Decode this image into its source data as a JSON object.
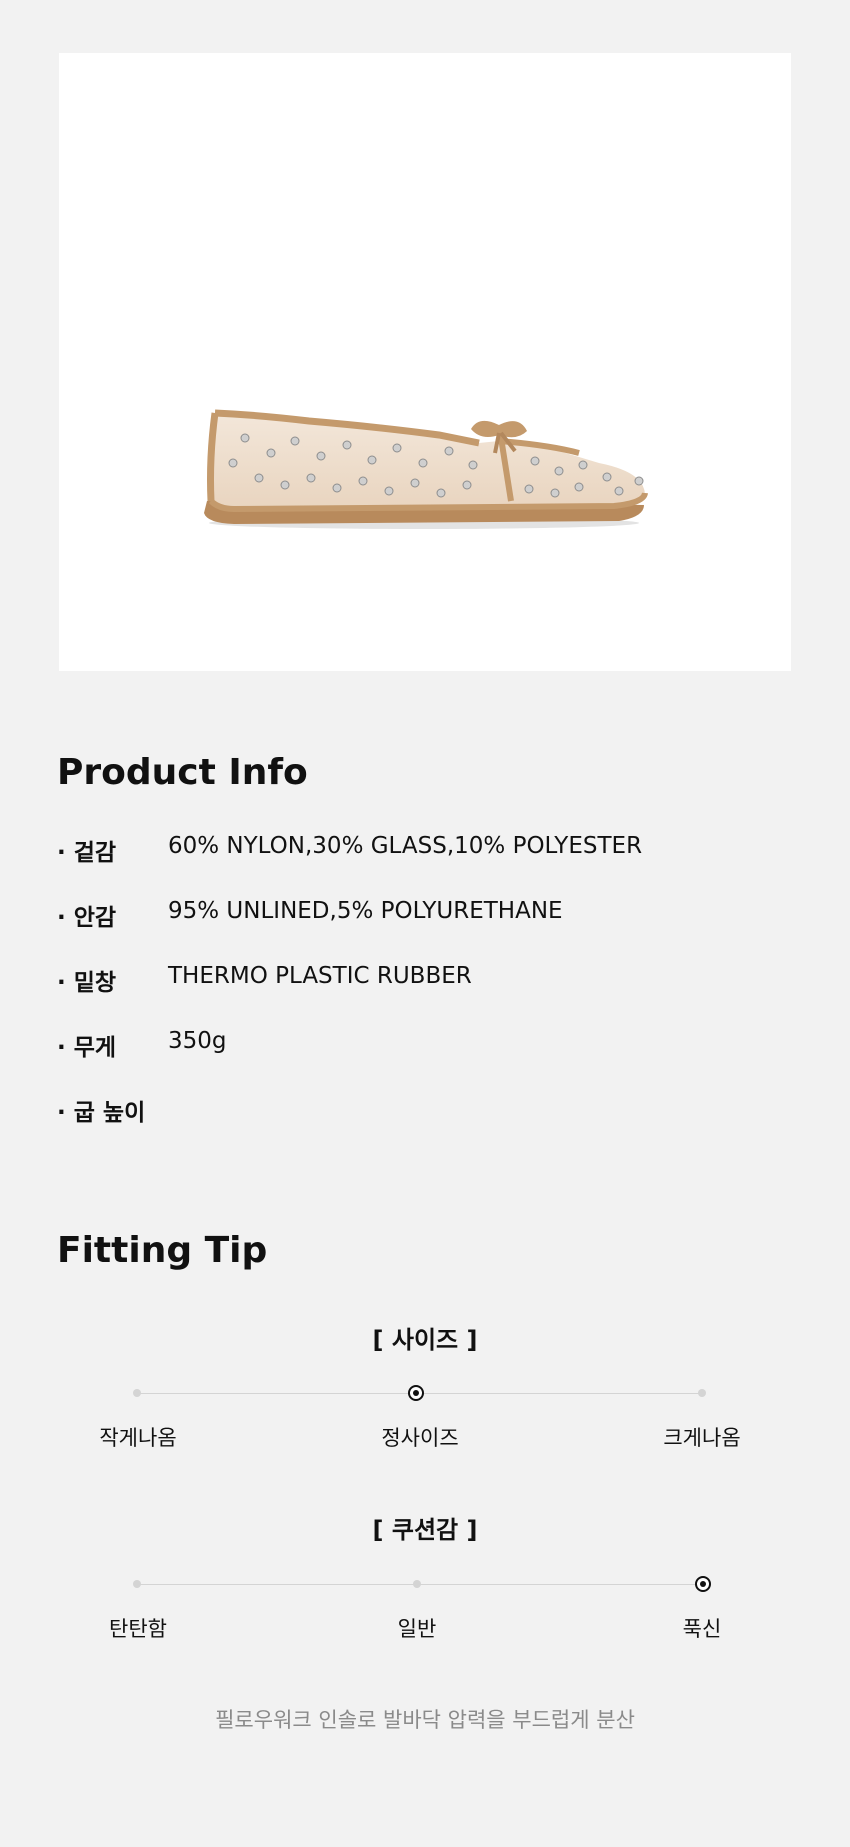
{
  "product_image": {
    "alt": "shoe-image"
  },
  "product_info": {
    "title": "Product Info",
    "rows": [
      {
        "label": "· 겉감",
        "value": "60% NYLON,30% GLASS,10% POLYESTER"
      },
      {
        "label": "· 안감",
        "value": "95% UNLINED,5% POLYURETHANE"
      },
      {
        "label": "· 밑창",
        "value": "THERMO PLASTIC RUBBER"
      },
      {
        "label": "· 무게",
        "value": "350g"
      },
      {
        "label": "· 굽 높이",
        "value": ""
      }
    ]
  },
  "fitting_tip": {
    "title": "Fitting Tip",
    "size": {
      "heading": "[ 사이즈 ]",
      "options": [
        "작게나옴",
        "정사이즈",
        "크게나옴"
      ],
      "selected_index": 1
    },
    "cushion": {
      "heading": "[ 쿠션감 ]",
      "options": [
        "탄탄함",
        "일반",
        "푹신"
      ],
      "selected_index": 2
    },
    "note": "필로우워크 인솔로 발바닥 압력을 부드럽게 분산"
  },
  "colors": {
    "background": "#f2f2f2",
    "accent": "#111111",
    "muted": "#8a8a8a",
    "shoe_trim": "#c49a6c"
  }
}
